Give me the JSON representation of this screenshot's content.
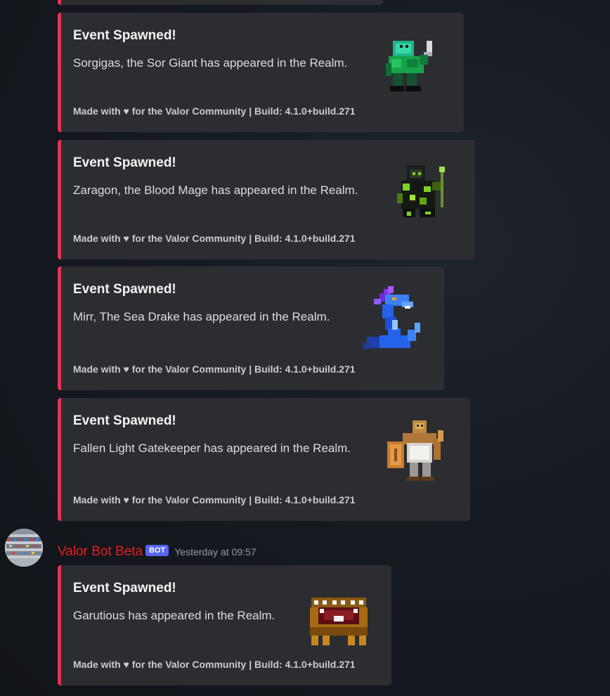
{
  "embeds": [
    {
      "title": "Event Spawned!",
      "description": "Sorgigas, the Sor Giant has appeared in the Realm.",
      "footer": "Made with ♥ for the Valor Community | Build: 4.1.0+build.271",
      "thumbnail_icon": "sor-giant-sprite-icon"
    },
    {
      "title": "Event Spawned!",
      "description": "Zaragon, the Blood Mage has appeared in the Realm.",
      "footer": "Made with ♥ for the Valor Community | Build: 4.1.0+build.271",
      "thumbnail_icon": "blood-mage-sprite-icon"
    },
    {
      "title": "Event Spawned!",
      "description": "Mirr, The Sea Drake has appeared in the Realm.",
      "footer": "Made with ♥ for the Valor Community | Build: 4.1.0+build.271",
      "thumbnail_icon": "sea-drake-sprite-icon"
    },
    {
      "title": "Event Spawned!",
      "description": "Fallen Light Gatekeeper has appeared in the Realm.",
      "footer": "Made with ♥ for the Valor Community | Build: 4.1.0+build.271",
      "thumbnail_icon": "gatekeeper-sprite-icon"
    },
    {
      "title": "Event Spawned!",
      "description": "Garutious has appeared in the Realm.",
      "footer": "Made with ♥ for the Valor Community | Build: 4.1.0+build.271",
      "thumbnail_icon": "garutious-sprite-icon"
    }
  ],
  "message": {
    "username": "Valor Bot Beta",
    "badge": "BOT",
    "timestamp": "Yesterday at 09:57",
    "avatar_icon": "bot-avatar-icon"
  },
  "colors": {
    "embed_border": "#e03450",
    "embed_background": "#2b2d31",
    "username": "#e61c1c",
    "bot_badge": "#5865f2"
  }
}
